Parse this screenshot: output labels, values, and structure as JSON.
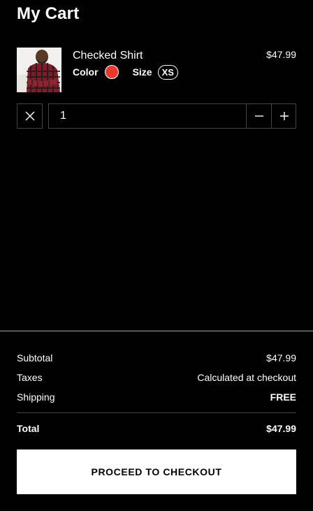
{
  "header": {
    "title": "My Cart"
  },
  "cart": {
    "items": [
      {
        "name": "Checked Shirt",
        "price": "$47.99",
        "color_label": "Color",
        "color_value": "#e53a2c",
        "size_label": "Size",
        "size_value": "XS",
        "quantity": "1",
        "image": "man-in-checked-shirt-photo"
      }
    ]
  },
  "icons": {
    "remove": "close-icon",
    "decrease": "minus-icon",
    "increase": "plus-icon"
  },
  "summary": {
    "subtotal_label": "Subtotal",
    "subtotal_value": "$47.99",
    "taxes_label": "Taxes",
    "taxes_value": "Calculated at checkout",
    "shipping_label": "Shipping",
    "shipping_value": "FREE",
    "total_label": "Total",
    "total_value": "$47.99"
  },
  "checkout": {
    "label": "PROCEED TO CHECKOUT"
  }
}
